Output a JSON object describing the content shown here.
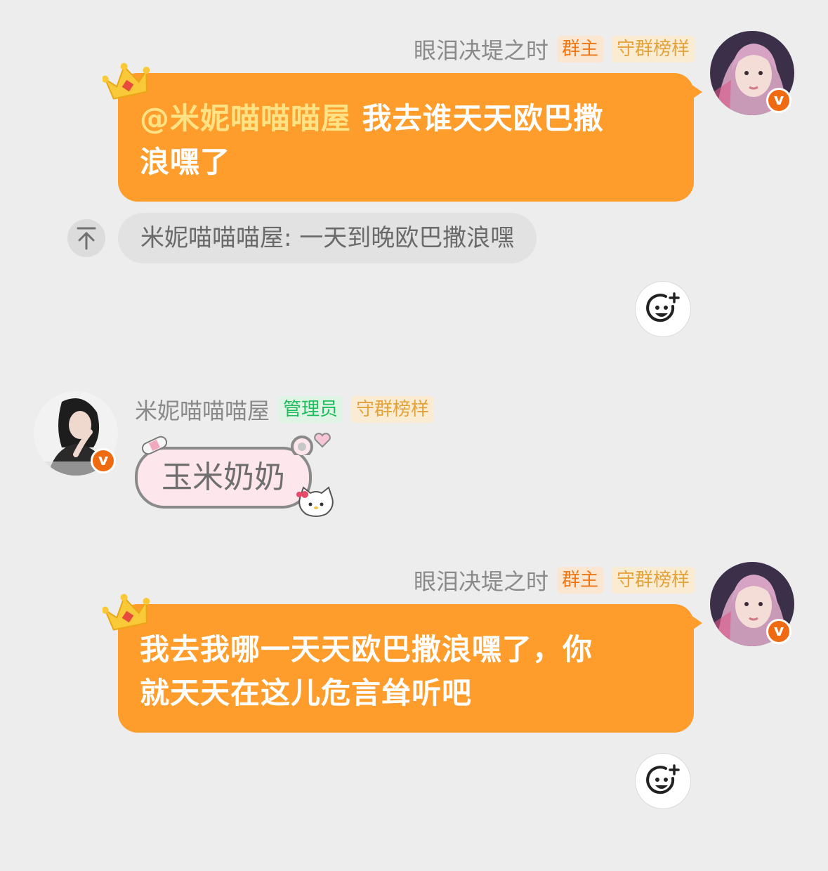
{
  "messages": [
    {
      "sender": "眼泪决堤之时",
      "badges": [
        "群主",
        "守群榜样"
      ],
      "mention": "@米妮喵喵喵屋",
      "text_line1": "我去谁天天欧巴撒",
      "text_line2": "浪嘿了",
      "quote": "米妮喵喵喵屋: 一天到晚欧巴撒浪嘿"
    },
    {
      "sender": "米妮喵喵喵屋",
      "badges": [
        "管理员",
        "守群榜样"
      ],
      "sticker_text": "玉米奶奶"
    },
    {
      "sender": "眼泪决堤之时",
      "badges": [
        "群主",
        "守群榜样"
      ],
      "text_line1": "我去我哪一天天欧巴撒浪嘿了，你",
      "text_line2": "就天天在这儿危言耸听吧"
    }
  ],
  "icons": {
    "verified": "v",
    "crown": "crown-icon",
    "quote_jump": "arrow-up-icon",
    "reaction": "add-emoji-icon"
  },
  "colors": {
    "bubble": "#fe9d2c",
    "mention": "#ffe283",
    "background": "#ededed",
    "owner_badge": "#ee7716",
    "admin_badge": "#1fbd5c",
    "guard_badge": "#e4a23a"
  }
}
